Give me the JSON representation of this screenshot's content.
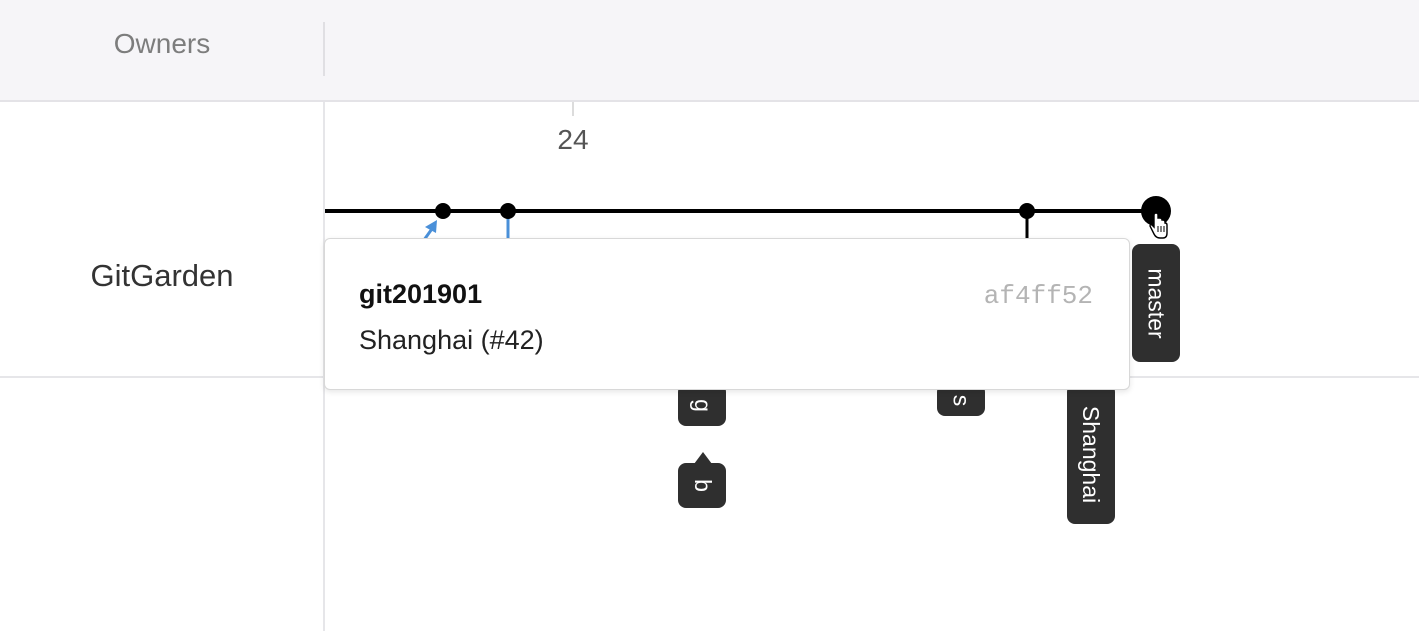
{
  "header": {
    "owners_label": "Owners"
  },
  "repo": {
    "name": "GitGarden"
  },
  "timeline": {
    "tick_label": "24"
  },
  "tooltip": {
    "repo": "git201901",
    "hash": "af4ff52",
    "branch": "Shanghai (#42)"
  },
  "tags": {
    "master": "master",
    "shanghai": "Shanghai",
    "partial_g": "g",
    "partial_s": "s",
    "partial_b": "b"
  },
  "colors": {
    "line": "#000000",
    "branch_blue": "#4a90d9",
    "tag_bg": "#2f2f2f",
    "header_bg": "#f6f5f8"
  }
}
